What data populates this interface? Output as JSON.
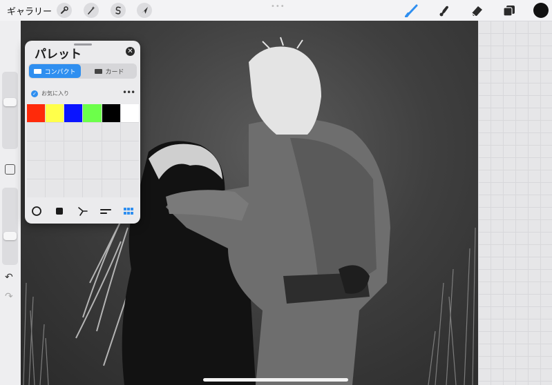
{
  "topbar": {
    "gallery_label": "ギャラリー",
    "left_tools": [
      "wrench-icon",
      "magic-wand-icon",
      "selection-s-icon",
      "arrow-cursor-icon"
    ],
    "right_tools": [
      "brush-icon",
      "smudge-icon",
      "eraser-icon",
      "layers-icon"
    ],
    "active_tool": "brush-icon",
    "current_color": "#111111",
    "accent_color": "#2f8ff0"
  },
  "sidebar": {
    "tools": [
      "brush-size-slider",
      "modify-button",
      "opacity-slider",
      "undo-icon",
      "redo-icon"
    ]
  },
  "palette": {
    "title": "パレット",
    "tabs": [
      {
        "label": "コンパクト",
        "active": true
      },
      {
        "label": "カード",
        "active": false
      }
    ],
    "favorite_label": "お気に入り",
    "swatches": [
      "#ff2a0a",
      "#ffff4a",
      "#0a14ff",
      "#6cff4a",
      "#000000",
      "#ffffff"
    ],
    "empty_swatch_count": 24,
    "bottom_tools": [
      "disc-icon",
      "classic-icon",
      "harmony-icon",
      "value-icon",
      "palettes-icon"
    ],
    "active_bottom_tool": "palettes-icon"
  }
}
